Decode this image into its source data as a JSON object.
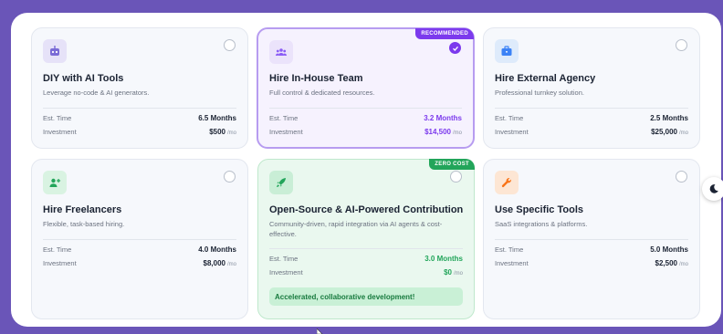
{
  "est_label": "Est. Time",
  "inv_label": "Investment",
  "unit": "/mo",
  "options": [
    {
      "title": "DIY with AI Tools",
      "desc": "Leverage no-code & AI generators.",
      "time": "6.5 Months",
      "cost": "$500",
      "icon": "robot-icon",
      "icon_color": "#7a6bd6",
      "icon_bg": "#e6e2f8"
    },
    {
      "title": "Hire In-House Team",
      "desc": "Full control & dedicated resources.",
      "time": "3.2 Months",
      "cost": "$14,500",
      "badge": "RECOMMENDED",
      "selected": true,
      "icon": "team-icon",
      "icon_color": "#8b5cf6",
      "icon_bg": "#ebe3fb"
    },
    {
      "title": "Hire External Agency",
      "desc": "Professional turnkey solution.",
      "time": "2.5 Months",
      "cost": "$25,000",
      "icon": "briefcase-icon",
      "icon_color": "#3b82f6",
      "icon_bg": "#deebfb"
    },
    {
      "title": "Hire Freelancers",
      "desc": "Flexible, task-based hiring.",
      "time": "4.0 Months",
      "cost": "$8,000",
      "icon": "user-plus-icon",
      "icon_color": "#22a55a",
      "icon_bg": "#d9f3e2"
    },
    {
      "title": "Open-Source & AI-Powered Contribution",
      "desc": "Community-driven, rapid integration via AI agents & cost-effective.",
      "time": "3.0 Months",
      "cost": "$0",
      "badge": "ZERO COST",
      "note": "Accelerated, collaborative development!",
      "icon": "rocket-icon",
      "icon_color": "#22a55a",
      "icon_bg": "#c9eed6"
    },
    {
      "title": "Use Specific Tools",
      "desc": "SaaS integrations & platforms.",
      "time": "5.0 Months",
      "cost": "$2,500",
      "icon": "wrench-icon",
      "icon_color": "#f97316",
      "icon_bg": "#fde6d4"
    }
  ],
  "colors": {
    "accent_purple": "#7c3aed",
    "accent_green": "#22a55a",
    "background": "#6a55b8"
  },
  "theme_toggle_icon": "moon-icon"
}
